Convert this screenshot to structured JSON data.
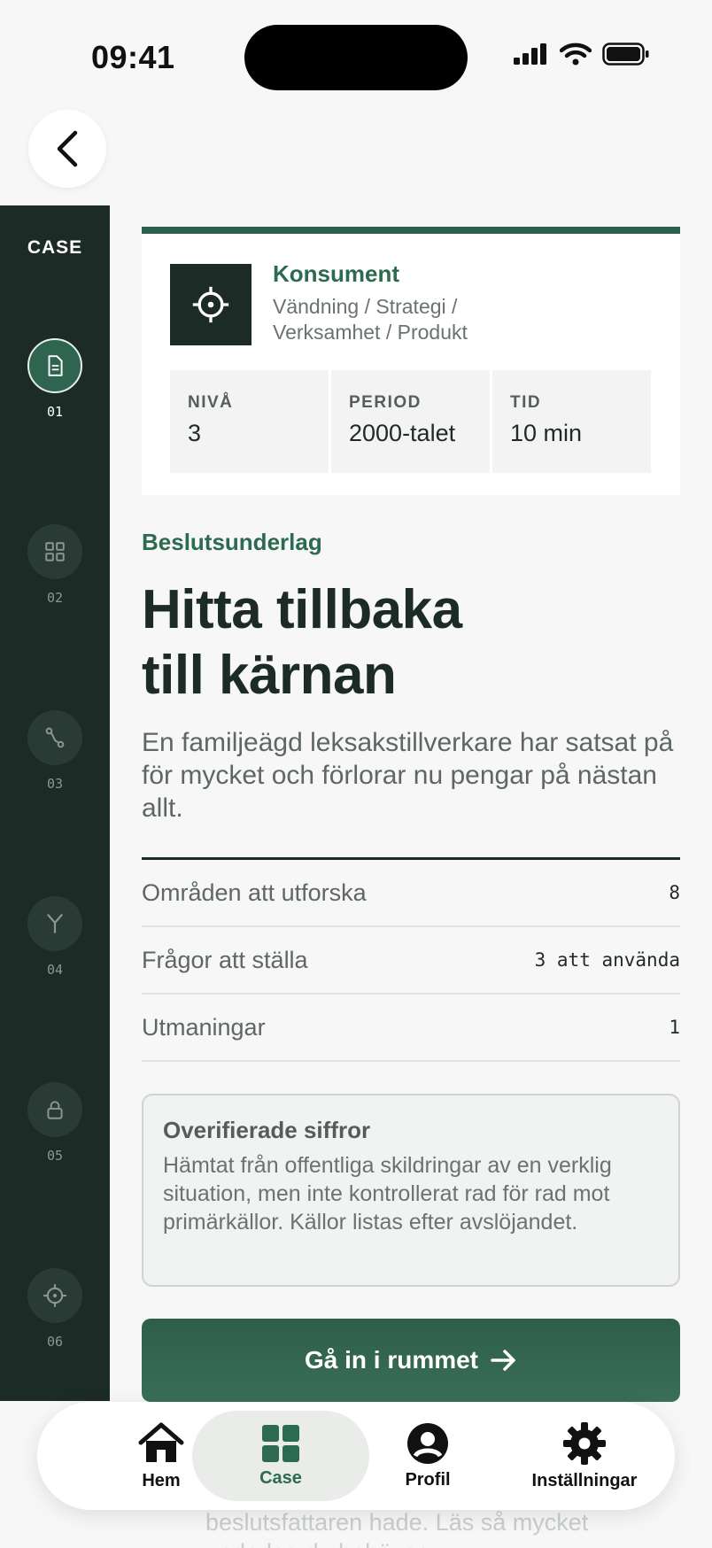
{
  "status": {
    "time": "09:41"
  },
  "rail": {
    "title": "CASE",
    "steps": [
      {
        "num": "01",
        "icon": "document-icon"
      },
      {
        "num": "02",
        "icon": "grid-icon"
      },
      {
        "num": "03",
        "icon": "route-icon"
      },
      {
        "num": "04",
        "icon": "fork-icon"
      },
      {
        "num": "05",
        "icon": "lock-icon"
      },
      {
        "num": "06",
        "icon": "target-icon"
      }
    ]
  },
  "card": {
    "category": "Konsument",
    "tags": "Vändning / Strategi / Verksamhet / Produkt",
    "metrics": [
      {
        "label": "NIVÅ",
        "value": "3"
      },
      {
        "label": "PERIOD",
        "value": "2000-talet"
      },
      {
        "label": "TID",
        "value": "10 min"
      }
    ]
  },
  "kicker": "Beslutsunderlag",
  "headline": {
    "line1": "Hitta tillbaka",
    "line2": "till kärnan"
  },
  "lead": "En familjeägd leksakstillverkare har satsat på för mycket och förlorar nu pengar på nästan allt.",
  "rows": [
    {
      "label": "Områden att utforska",
      "value": "8"
    },
    {
      "label": "Frågor att ställa",
      "value": "3 att använda"
    },
    {
      "label": "Utmaningar",
      "value": "1"
    }
  ],
  "notice": {
    "title": "Overifierade siffror",
    "body": "Hämtat från offentliga skildringar av en verklig situation, men inte kontrollerat rad för rad mot primärkällor. Källor listas efter avslöjandet."
  },
  "cta": {
    "label": "Gå in i rummet"
  },
  "under": {
    "line1": "beslutsfattaren hade. Läs så mycket",
    "line2": "underlag du behöver."
  },
  "nav": {
    "items": [
      {
        "label": "Hem",
        "icon": "home-icon"
      },
      {
        "label": "Case",
        "icon": "grid-icon"
      },
      {
        "label": "Profil",
        "icon": "profile-icon"
      },
      {
        "label": "Inställningar",
        "icon": "gear-icon"
      }
    ]
  },
  "colors": {
    "accent": "#2d6a52",
    "rail": "#1d2b26",
    "cta": "#2d5e4b"
  }
}
